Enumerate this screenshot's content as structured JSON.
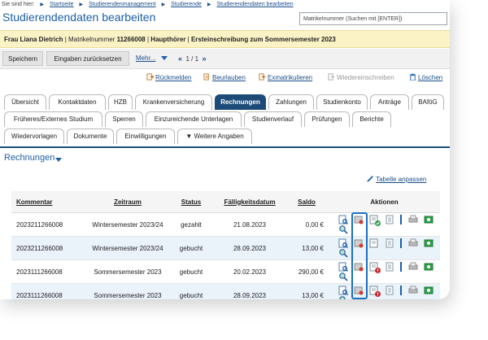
{
  "breadcrumb": {
    "lead": "Sie sind hier:",
    "items": [
      "Startseite",
      "Studierendenmanagement",
      "Studierende",
      "Studierendendaten bearbeiten"
    ]
  },
  "page_title": "Studierendendaten bearbeiten",
  "search": {
    "placeholder": "Matrikelnummer (Suchen mit [ENTER])"
  },
  "info": {
    "name": "Frau Liana Dietrich",
    "matrikel_label": "Matrikelnummer",
    "matrikel": "11266008",
    "status": "Haupthörer",
    "enrollment": "Ersteinschreibung zum Sommersemester 2023"
  },
  "toolbar": {
    "save": "Speichern",
    "reset": "Eingaben zurücksetzen",
    "more": "Mehr...",
    "page": "1 / 1",
    "first": "«",
    "last": "»"
  },
  "actions": {
    "rueckmelden": "Rückmelden",
    "beurlauben": "Beurlauben",
    "exmatrikulieren": "Exmatrikulieren",
    "wiedereinschreiben": "Wiedereinschreiben",
    "loeschen": "Löschen"
  },
  "tabs": {
    "row1": [
      "Übersicht",
      "Kontaktdaten",
      "HZB",
      "Krankenversicherung",
      "Rechnungen",
      "Zahlungen",
      "Studienkonto",
      "Anträge",
      "BAföG"
    ],
    "row2": [
      "Früheres/Externes Studium",
      "Sperren",
      "Einzureichende Unterlagen",
      "Studienverlauf",
      "Prüfungen",
      "Berichte"
    ],
    "row3": [
      "Wiedervorlagen",
      "Dokumente",
      "Einwilligungen",
      "▼ Weitere Angaben"
    ],
    "active": "Rechnungen"
  },
  "section": {
    "title": "Rechnungen",
    "adjust_table": "Tabelle anpassen"
  },
  "table": {
    "headers": {
      "kommentar": "Kommentar",
      "zeitraum": "Zeitraum",
      "status": "Status",
      "faelligkeit": "Fälligkeitsdatum",
      "saldo": "Saldo",
      "aktionen": "Aktionen"
    },
    "rows": [
      {
        "kommentar": "2023211266008",
        "zeitraum": "Wintersemester 2023/24",
        "status": "gezahlt",
        "faelligkeit": "21.08.2023",
        "saldo": "0,00 €",
        "marker": "check"
      },
      {
        "kommentar": "2023211266008",
        "zeitraum": "Wintersemester 2023/24",
        "status": "gebucht",
        "faelligkeit": "28.09.2023",
        "saldo": "13,00 €",
        "marker": "none"
      },
      {
        "kommentar": "2023111266008",
        "zeitraum": "Sommersemester 2023",
        "status": "gebucht",
        "faelligkeit": "20.02.2023",
        "saldo": "290,00 €",
        "marker": "alert"
      },
      {
        "kommentar": "2023111266008",
        "zeitraum": "Sommersemester 2023",
        "status": "gebucht",
        "faelligkeit": "28.09.2023",
        "saldo": "13,00 €",
        "marker": "alert"
      }
    ],
    "row_icons": [
      "view-invoice-icon",
      "cancel-invoice-icon",
      "invoice-status-icon",
      "document-icon",
      "print-icon",
      "payment-icon",
      "search-detail-icon"
    ]
  },
  "colors": {
    "accent": "#1b5fa8",
    "tab_active": "#1d4b78",
    "info_bar": "#fbf3c6",
    "row_alt": "#eaf2fa"
  }
}
